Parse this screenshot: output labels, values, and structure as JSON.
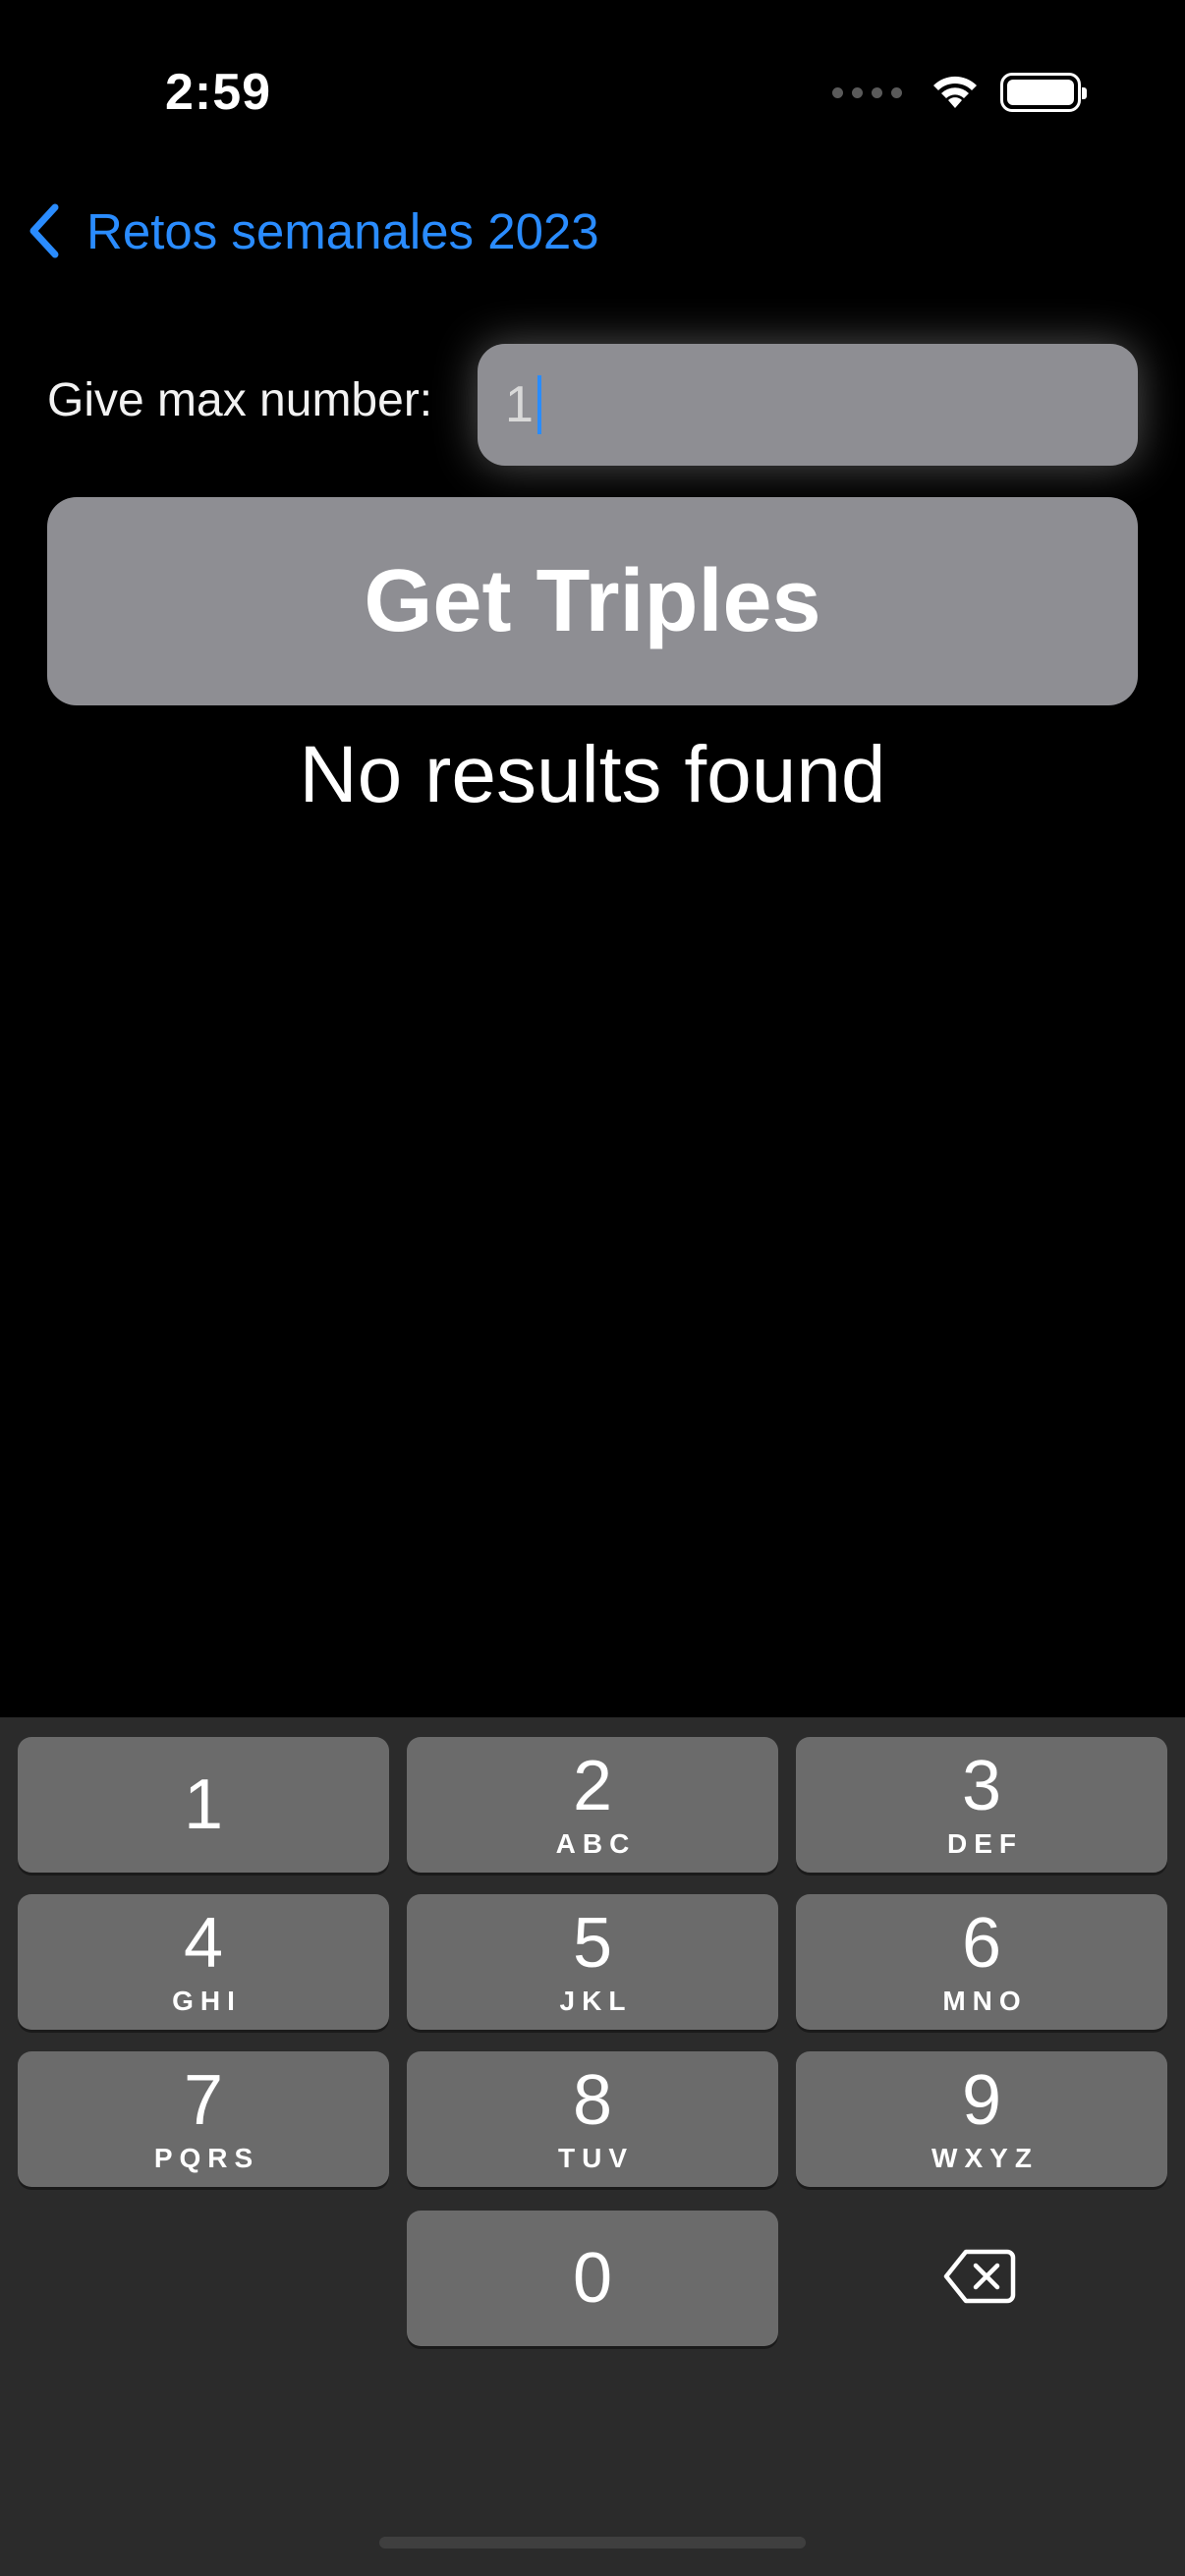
{
  "status_bar": {
    "time": "2:59",
    "icons": [
      "cellular-signal-icon",
      "wifi-icon",
      "battery-icon"
    ]
  },
  "nav": {
    "back_label": "Retos semanales 2023",
    "back_icon": "chevron-left-icon"
  },
  "form": {
    "label": "Give max number:",
    "input_value": "1"
  },
  "action": {
    "button_label": "Get Triples"
  },
  "result": {
    "message": "No results found"
  },
  "keypad": {
    "keys": [
      {
        "digit": "1",
        "letters": ""
      },
      {
        "digit": "2",
        "letters": "ABC"
      },
      {
        "digit": "3",
        "letters": "DEF"
      },
      {
        "digit": "4",
        "letters": "GHI"
      },
      {
        "digit": "5",
        "letters": "JKL"
      },
      {
        "digit": "6",
        "letters": "MNO"
      },
      {
        "digit": "7",
        "letters": "PQRS"
      },
      {
        "digit": "8",
        "letters": "TUV"
      },
      {
        "digit": "9",
        "letters": "WXYZ"
      },
      {
        "digit": "0",
        "letters": ""
      }
    ],
    "delete_icon": "backspace-icon"
  },
  "colors": {
    "accent": "#2a8cff",
    "background": "#000000",
    "button": "#8e8e93",
    "keyboard": "#2b2b2b",
    "key": "#6b6b6b"
  }
}
